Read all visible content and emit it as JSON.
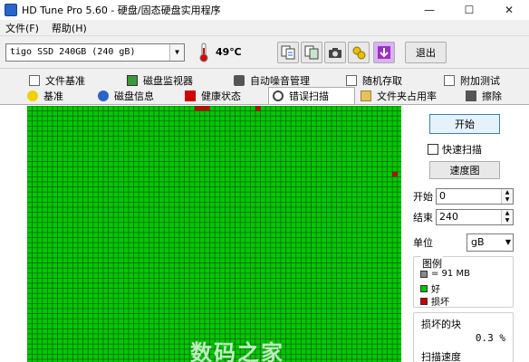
{
  "window": {
    "title": "HD Tune Pro 5.60 - 硬盘/固态硬盘实用程序",
    "minimize": "—",
    "maximize": "☐",
    "close": "✕"
  },
  "menu": {
    "file": "文件(F)",
    "help": "帮助(H)"
  },
  "toolbar": {
    "drive": "tigo SSD 240GB (240 gB)",
    "temperature": "49℃",
    "exit_label": "退出",
    "icons": [
      "copy-info-icon",
      "copy-screen-icon",
      "screenshot-icon",
      "options-icon",
      "save-icon"
    ]
  },
  "tabs": {
    "row1": [
      "文件基准",
      "磁盘监视器",
      "自动噪音管理",
      "随机存取",
      "附加测试"
    ],
    "row2": [
      "基准",
      "磁盘信息",
      "健康状态",
      "错误扫描",
      "文件夹占用率",
      "擦除"
    ],
    "active": "错误扫描"
  },
  "scan_panel": {
    "start_label": "开始",
    "quick_scan_label": "快速扫描",
    "quick_scan_checked": false,
    "speed_map_label": "速度图",
    "start_field_label": "开始",
    "start_value": "0",
    "end_field_label": "结束",
    "end_value": "240",
    "unit_label": "单位",
    "unit_value": "gB",
    "legend": {
      "title": "图例",
      "block_size": "= 91 MB",
      "good": "好",
      "damaged": "损坏"
    },
    "damaged_blocks_label": "损坏的块",
    "damaged_blocks_value": "0.3 %",
    "scan_speed_label": "扫描速度"
  },
  "block_map": {
    "colors": {
      "good": "#00c800",
      "bad": "#c80000",
      "border": "#1a5a1a"
    },
    "bad_blocks": [
      {
        "row": 0,
        "col": 33
      },
      {
        "row": 0,
        "col": 34
      },
      {
        "row": 0,
        "col": 35
      },
      {
        "row": 0,
        "col": 45
      },
      {
        "row": 13,
        "col": 72
      }
    ]
  },
  "watermark": "数码之家"
}
